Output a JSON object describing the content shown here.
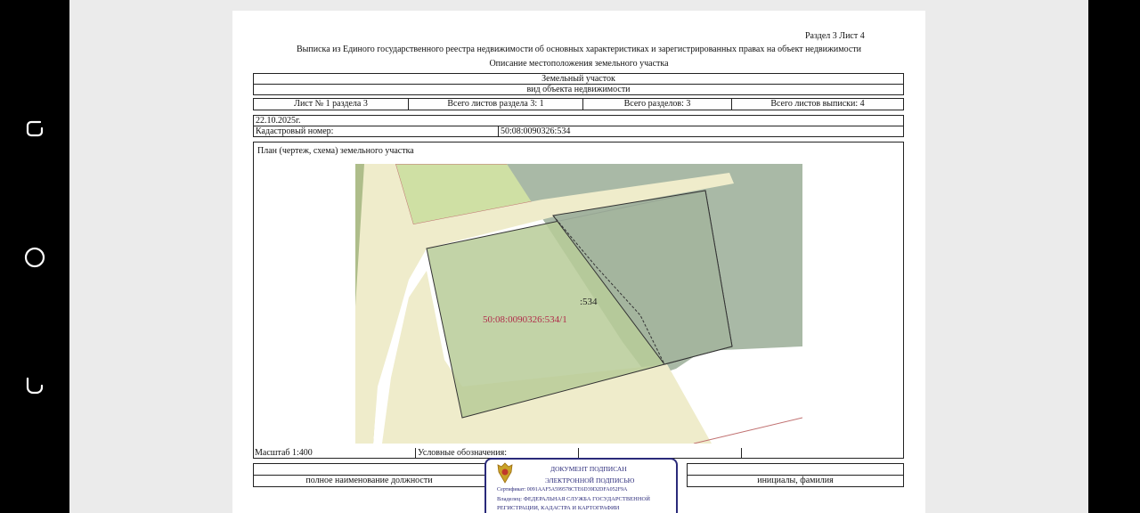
{
  "document": {
    "section_sheet": "Раздел 3    Лист 4",
    "header_line1": "Выписка из Единого государственного реестра недвижимости об основных характеристиках и зарегистрированных правах на объект недвижимости",
    "header_line2": "Описание местоположения земельного участка",
    "object_type": "Земельный участок",
    "object_type_caption": "вид объекта недвижимости",
    "sheet_info": {
      "sheet_no": "Лист № 1 раздела 3",
      "total_section_sheets": "Всего листов раздела 3: 1",
      "total_sections": "Всего разделов: 3",
      "total_extract_sheets": "Всего листов выписки: 4"
    },
    "date": "22.10.2025г.",
    "cadastral_label": "Кадастровый номер:",
    "cadastral_number": "50:08:0090326:534",
    "plan_title": "План (чертеж, схема) земельного участка",
    "map_labels": {
      "parcel": ":534",
      "subparcel": "50:08:0090326:534/1"
    },
    "scale": "Масштаб 1:400",
    "legend_label": "Условные обозначения:",
    "position_caption": "полное наименование должности",
    "initials_caption": "инициалы, фамилия"
  },
  "stamp": {
    "line1": "ДОКУМЕНТ ПОДПИСАН",
    "line2": "ЭЛЕКТРОННОЙ ПОДПИСЬЮ",
    "certificate": "Сертификат: 0091AAF5A599578CTE6D39D2DFA052F9A",
    "owner_line1": "Владелец: ФЕДЕРАЛЬНАЯ СЛУЖБА ГОСУДАРСТВЕННОЙ",
    "owner_line2": "РЕГИСТРАЦИИ, КАДАСТРА И КАРТОГРАФИИ"
  },
  "colors": {
    "road": "#efeccb",
    "green_dark": "#aebd8a",
    "green_light": "#cfe0a4",
    "parcel_fill": "#b7cb98",
    "gray_overlay": "#a9b9a6",
    "subparcel_label": "#b02c4a"
  },
  "navigation_icons": [
    "recent-apps-icon",
    "home-icon",
    "back-icon"
  ]
}
